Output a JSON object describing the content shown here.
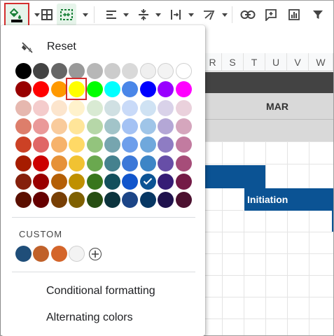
{
  "toolbar": {
    "buttons": [
      {
        "name": "fill-color",
        "icon": "paint-bucket-icon"
      },
      {
        "name": "borders",
        "icon": "borders-icon"
      },
      {
        "name": "merge-cells",
        "icon": "merge-cells-icon"
      },
      {
        "name": "horizontal-align",
        "icon": "align-left-icon"
      },
      {
        "name": "vertical-align",
        "icon": "vertical-align-icon"
      },
      {
        "name": "text-wrapping",
        "icon": "text-wrap-icon"
      },
      {
        "name": "text-rotation",
        "icon": "text-rotation-icon"
      },
      {
        "name": "insert-link",
        "icon": "link-icon"
      },
      {
        "name": "insert-comment",
        "icon": "comment-icon"
      },
      {
        "name": "insert-chart",
        "icon": "chart-icon"
      },
      {
        "name": "create-filter",
        "icon": "filter-icon"
      }
    ]
  },
  "sheet": {
    "columns": [
      "R",
      "S",
      "T",
      "U",
      "V",
      "W"
    ],
    "month_label": "MAR",
    "task_label": "Initiation",
    "colors": {
      "dark_header": "#434343",
      "light_band": "#d9d9d9",
      "task_blue": "#0b5394",
      "header_bg": "#f8f9fa"
    }
  },
  "fill_menu": {
    "reset_label": "Reset",
    "palette": [
      [
        "#000000",
        "#434343",
        "#666666",
        "#999999",
        "#b7b7b7",
        "#cccccc",
        "#d9d9d9",
        "#efefef",
        "#f3f3f3",
        "#ffffff"
      ],
      [
        "#980000",
        "#ff0000",
        "#ff9900",
        "#ffff00",
        "#00ff00",
        "#00ffff",
        "#4a86e8",
        "#0000ff",
        "#9900ff",
        "#ff00ff"
      ],
      [
        "#e6b8af",
        "#f4cccc",
        "#fce5cd",
        "#fff2cc",
        "#d9ead3",
        "#d0e0e3",
        "#c9daf8",
        "#cfe2f3",
        "#d9d2e9",
        "#ead1dc"
      ],
      [
        "#dd7e6b",
        "#ea9999",
        "#f9cb9c",
        "#ffe599",
        "#b6d7a8",
        "#a2c4c9",
        "#a4c2f4",
        "#9fc5e8",
        "#b4a7d6",
        "#d5a6bd"
      ],
      [
        "#cc4125",
        "#e06666",
        "#f6b26b",
        "#ffd966",
        "#93c47d",
        "#76a5af",
        "#6d9eeb",
        "#6fa8dc",
        "#8e7cc3",
        "#c27ba0"
      ],
      [
        "#a61c00",
        "#cc0000",
        "#e69138",
        "#f1c232",
        "#6aa84f",
        "#45818e",
        "#3c78d8",
        "#3d85c6",
        "#674ea7",
        "#a64d79"
      ],
      [
        "#85200c",
        "#990000",
        "#b45f06",
        "#bf9000",
        "#38761d",
        "#134f5c",
        "#1155cc",
        "#0b5394",
        "#351c75",
        "#741b47"
      ],
      [
        "#5b0f00",
        "#660000",
        "#783f04",
        "#7f6000",
        "#274e13",
        "#0c343d",
        "#1c4587",
        "#073763",
        "#20124d",
        "#4c1130"
      ]
    ],
    "selected_swatch": "#ffff00",
    "checked_swatch": "#0b5394",
    "custom_label": "CUSTOM",
    "custom_colors": [
      "#1f4e79",
      "#c0612a",
      "#d4652a",
      "#f3f3f3"
    ],
    "add_custom_icon": "add-circle-icon",
    "menu_items": [
      "Conditional formatting",
      "Alternating colors"
    ]
  }
}
